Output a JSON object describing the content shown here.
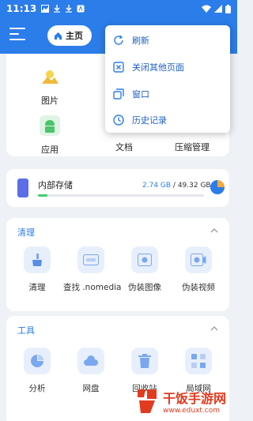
{
  "status_bar": {
    "time": "11:13"
  },
  "app_bar": {
    "home_tab": "主页"
  },
  "categories": [
    {
      "label": "图片",
      "icon": "image-icon"
    },
    {
      "label": "应用",
      "icon": "android-icon"
    },
    {
      "label": "文档",
      "icon": "document-icon"
    },
    {
      "label": "压缩管理",
      "icon": "archive-icon"
    }
  ],
  "storage": {
    "title": "内部存储",
    "used": "2.74 GB",
    "separator": " / ",
    "total": "49.32 GB",
    "fill": 0.056
  },
  "clean_section": {
    "title": "清理",
    "items": [
      {
        "label": "清理",
        "icon": "broom-icon"
      },
      {
        "label": "查找 .nomedia",
        "icon": "nomedia-icon"
      },
      {
        "label": "伪装图像",
        "icon": "disguise-image-icon"
      },
      {
        "label": "伪装视频",
        "icon": "disguise-video-icon"
      }
    ]
  },
  "tools_section": {
    "title": "工具",
    "items": [
      {
        "label": "分析",
        "icon": "analysis-icon"
      },
      {
        "label": "网盘",
        "icon": "cloud-icon"
      },
      {
        "label": "回收站",
        "icon": "trash-icon"
      },
      {
        "label": "局域网",
        "icon": "lan-icon"
      }
    ]
  },
  "popup_menu": {
    "items": [
      {
        "label": "刷新",
        "icon": "refresh-icon"
      },
      {
        "label": "关闭其他页面",
        "icon": "close-others-icon"
      },
      {
        "label": "窗口",
        "icon": "windows-icon"
      },
      {
        "label": "历史记录",
        "icon": "history-icon"
      }
    ]
  },
  "watermark": {
    "title": "干饭手游网",
    "url": "www.eduxt.com"
  },
  "colors": {
    "primary": "#2b7de9",
    "progress": "#3ccf6e",
    "watermark": "#e23a1f"
  }
}
